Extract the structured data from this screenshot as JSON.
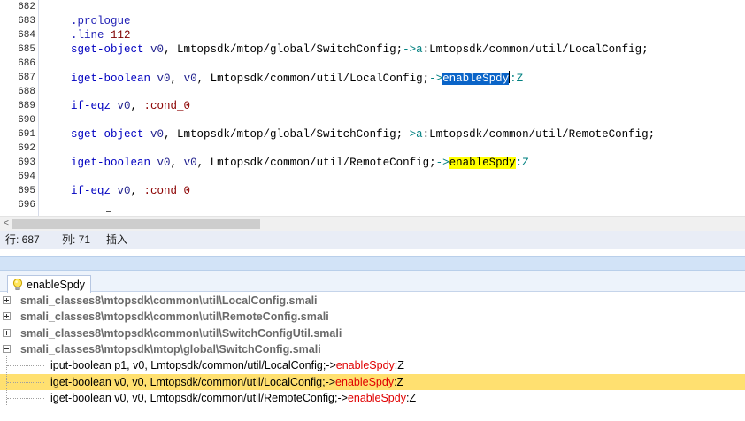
{
  "editor": {
    "lines": [
      {
        "num": "682",
        "segments": []
      },
      {
        "num": "683",
        "segments": [
          {
            "t": ".prologue",
            "c": "tk-dir"
          }
        ]
      },
      {
        "num": "684",
        "segments": [
          {
            "t": ".line ",
            "c": "tk-dir"
          },
          {
            "t": "112",
            "c": "tk-num"
          }
        ]
      },
      {
        "num": "685",
        "segments": [
          {
            "t": "sget-object ",
            "c": "kw-blue"
          },
          {
            "t": "v0",
            "c": "tk-reg"
          },
          {
            "t": ", Lmtopsdk/mtop/global/SwitchConfig;",
            "c": ""
          },
          {
            "t": "->",
            "c": "tk-ref"
          },
          {
            "t": "a",
            "c": "tk-ref"
          },
          {
            "t": ":Lmtopsdk/common/util/LocalConfig;",
            "c": ""
          }
        ]
      },
      {
        "num": "686",
        "segments": []
      },
      {
        "num": "687",
        "segments": [
          {
            "t": "iget-boolean ",
            "c": "kw-blue"
          },
          {
            "t": "v0",
            "c": "tk-reg"
          },
          {
            "t": ", ",
            "c": ""
          },
          {
            "t": "v0",
            "c": "tk-reg"
          },
          {
            "t": ", Lmtopsdk/common/util/LocalConfig;",
            "c": ""
          },
          {
            "t": "->",
            "c": "tk-ref"
          },
          {
            "t": "enableSpdy",
            "c": "sel"
          },
          {
            "t": "",
            "c": "caret"
          },
          {
            "t": ":Z",
            "c": "tk-ref"
          }
        ]
      },
      {
        "num": "688",
        "segments": []
      },
      {
        "num": "689",
        "segments": [
          {
            "t": "if-eqz ",
            "c": "kw-blue"
          },
          {
            "t": "v0",
            "c": "tk-reg"
          },
          {
            "t": ", ",
            "c": ""
          },
          {
            "t": ":cond_0",
            "c": "tk-lbl"
          }
        ]
      },
      {
        "num": "690",
        "segments": []
      },
      {
        "num": "691",
        "segments": [
          {
            "t": "sget-object ",
            "c": "kw-blue"
          },
          {
            "t": "v0",
            "c": "tk-reg"
          },
          {
            "t": ", Lmtopsdk/mtop/global/SwitchConfig;",
            "c": ""
          },
          {
            "t": "->",
            "c": "tk-ref"
          },
          {
            "t": "a",
            "c": "tk-ref"
          },
          {
            "t": ":Lmtopsdk/common/util/RemoteConfig;",
            "c": ""
          }
        ]
      },
      {
        "num": "692",
        "segments": []
      },
      {
        "num": "693",
        "segments": [
          {
            "t": "iget-boolean ",
            "c": "kw-blue"
          },
          {
            "t": "v0",
            "c": "tk-reg"
          },
          {
            "t": ", ",
            "c": ""
          },
          {
            "t": "v0",
            "c": "tk-reg"
          },
          {
            "t": ", Lmtopsdk/common/util/RemoteConfig;",
            "c": ""
          },
          {
            "t": "->",
            "c": "tk-ref"
          },
          {
            "t": "enableSpdy",
            "c": "hl"
          },
          {
            "t": ":Z",
            "c": "tk-ref"
          }
        ]
      },
      {
        "num": "694",
        "segments": []
      },
      {
        "num": "695",
        "segments": [
          {
            "t": "if-eqz ",
            "c": "kw-blue"
          },
          {
            "t": "v0",
            "c": "tk-reg"
          },
          {
            "t": ", ",
            "c": ""
          },
          {
            "t": ":cond_0",
            "c": "tk-lbl"
          }
        ]
      },
      {
        "num": "696",
        "segments": []
      }
    ]
  },
  "scrollbar": {
    "left_arrow": "<"
  },
  "status": {
    "row_label": "行: 687",
    "col_label": "列: 71",
    "mode_label": "插入"
  },
  "results_tab": {
    "label": "enableSpdy",
    "icon": "lightbulb-icon"
  },
  "results": {
    "files": [
      {
        "path": "smali_classes8\\mtopsdk\\common\\util\\LocalConfig.smali",
        "expanded": false
      },
      {
        "path": "smali_classes8\\mtopsdk\\common\\util\\RemoteConfig.smali",
        "expanded": false
      },
      {
        "path": "smali_classes8\\mtopsdk\\common\\util\\SwitchConfigUtil.smali",
        "expanded": false
      },
      {
        "path": "smali_classes8\\mtopsdk\\mtop\\global\\SwitchConfig.smali",
        "expanded": true
      }
    ],
    "matches": [
      {
        "prefix": "iput-boolean p1, v0, Lmtopsdk/common/util/LocalConfig;->",
        "hit": "enableSpdy",
        "suffix": ":Z",
        "selected": false
      },
      {
        "prefix": "iget-boolean v0, v0, Lmtopsdk/common/util/LocalConfig;->",
        "hit": "enableSpdy",
        "suffix": ":Z",
        "selected": true
      },
      {
        "prefix": "iget-boolean v0, v0, Lmtopsdk/common/util/RemoteConfig;->",
        "hit": "enableSpdy",
        "suffix": ":Z",
        "selected": false
      }
    ]
  },
  "colors": {
    "selection": "#0a64c8",
    "highlight": "#ffff00",
    "selected_row": "#ffe070",
    "hit_text": "#e00000"
  }
}
